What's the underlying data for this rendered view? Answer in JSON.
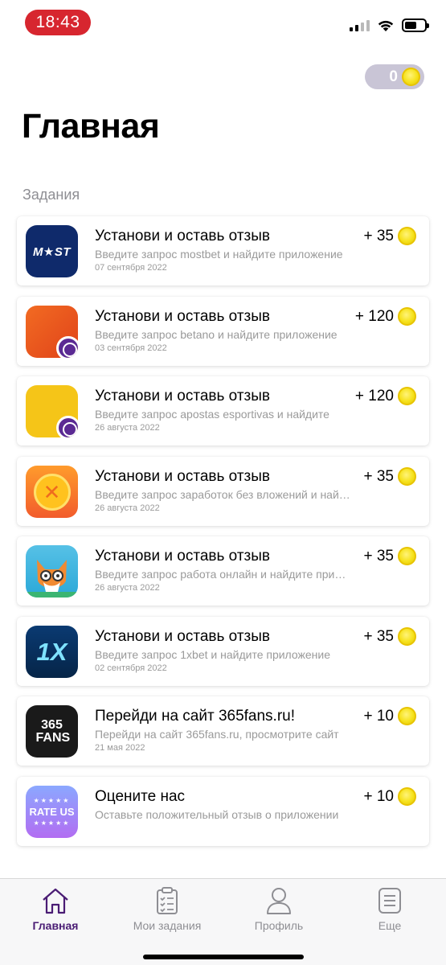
{
  "status_bar": {
    "time": "18:43"
  },
  "header": {
    "balance": "0",
    "title": "Главная",
    "section_label": "Задания"
  },
  "tasks": [
    {
      "icon": "mostbet-app-icon",
      "icon_text": "M★ST",
      "title": "Установи и оставь отзыв",
      "description": "Введите запрос mostbet и найдите приложение",
      "date": "07 сентября 2022",
      "reward": "+ 35"
    },
    {
      "icon": "betano-app-icon",
      "icon_text": "",
      "title": "Установи и оставь отзыв",
      "description": "Введите запрос betano и найдите приложение",
      "date": "03 сентября 2022",
      "reward": "+ 120"
    },
    {
      "icon": "sport-app-icon",
      "icon_text": "",
      "title": "Установи и оставь отзыв",
      "description": "Введите запрос apostas esportivas и найдите",
      "date": "26 августа 2022",
      "reward": "+ 120"
    },
    {
      "icon": "coin-app-icon",
      "icon_text": "",
      "title": "Установи и оставь отзыв",
      "description": "Введите запрос заработок без вложений и найдите",
      "date": "26 августа 2022",
      "reward": "+ 35"
    },
    {
      "icon": "fox-app-icon",
      "icon_text": "",
      "title": "Установи и оставь отзыв",
      "description": "Введите запрос работа онлайн и найдите приложение",
      "date": "26 августа 2022",
      "reward": "+ 35"
    },
    {
      "icon": "1xbet-app-icon",
      "icon_text": "1X",
      "title": "Установи и оставь отзыв",
      "description": "Введите запрос 1xbet и найдите приложение",
      "date": "02 сентября 2022",
      "reward": "+ 35"
    },
    {
      "icon": "365fans-app-icon",
      "icon_text": "365 FANS",
      "title": "Перейди на сайт 365fans.ru!",
      "description": "Перейди на сайт 365fans.ru, просмотрите сайт",
      "date": "21 мая 2022",
      "reward": "+ 10"
    },
    {
      "icon": "rate-us-app-icon",
      "icon_text": "RATE US",
      "title": "Оцените нас",
      "description": "Оставьте положительный отзыв о приложении",
      "date": "",
      "reward": "+ 10"
    }
  ],
  "tab_bar": {
    "items": [
      {
        "label": "Главная",
        "icon": "home-icon",
        "active": true
      },
      {
        "label": "Мои задания",
        "icon": "clipboard-icon",
        "active": false
      },
      {
        "label": "Профиль",
        "icon": "profile-icon",
        "active": false
      },
      {
        "label": "Еще",
        "icon": "more-icon",
        "active": false
      }
    ]
  },
  "colors": {
    "time_pill": "#d7262f",
    "coin": "#f6e21c",
    "active_tab": "#4a1c74",
    "balance_pill": "#c9c5d6"
  }
}
